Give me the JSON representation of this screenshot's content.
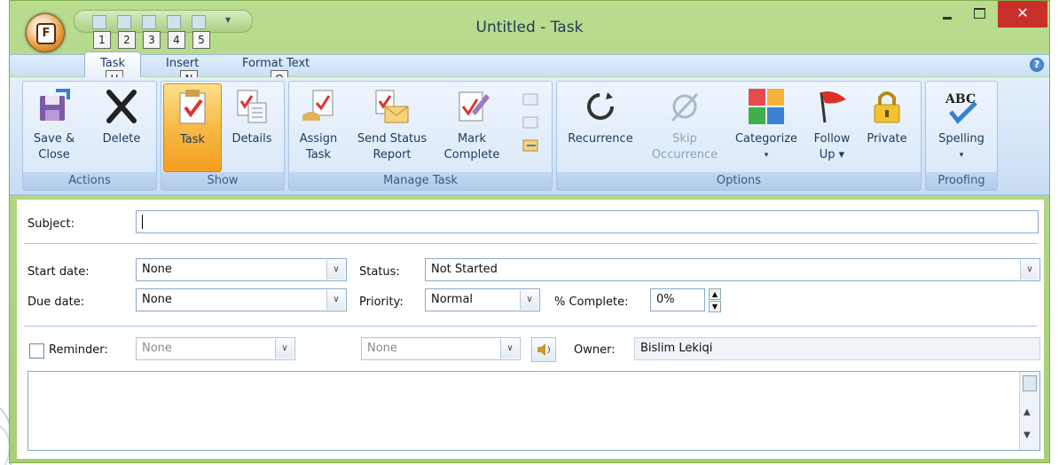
{
  "window": {
    "title": "Untitled - Task",
    "office_button_label": "F",
    "qat_keytips": [
      "1",
      "2",
      "3",
      "4",
      "5"
    ],
    "tab_keytips": [
      "H",
      "N",
      "O"
    ],
    "minimize_icon": "minimize-icon",
    "maximize_icon": "maximize-icon",
    "close_icon": "close-icon",
    "close_color": "#c9302c"
  },
  "tabs": [
    {
      "label": "Task",
      "active": true
    },
    {
      "label": "Insert",
      "active": false
    },
    {
      "label": "Format Text",
      "active": false
    }
  ],
  "help_label": "?",
  "ribbon": {
    "groups": [
      {
        "label": "Actions",
        "buttons": [
          {
            "label1": "Save &",
            "label2": "Close",
            "icon": "save-close-icon"
          },
          {
            "label1": "Delete",
            "label2": "",
            "icon": "delete-icon"
          }
        ]
      },
      {
        "label": "Show",
        "buttons": [
          {
            "label1": "Task",
            "label2": "",
            "icon": "task-icon",
            "selected": true
          },
          {
            "label1": "Details",
            "label2": "",
            "icon": "details-icon"
          }
        ]
      },
      {
        "label": "Manage Task",
        "buttons": [
          {
            "label1": "Assign",
            "label2": "Task",
            "icon": "assign-task-icon"
          },
          {
            "label1": "Send Status",
            "label2": "Report",
            "icon": "send-status-icon"
          },
          {
            "label1": "Mark",
            "label2": "Complete",
            "icon": "mark-complete-icon"
          }
        ]
      },
      {
        "label": "Options",
        "buttons": [
          {
            "label1": "Recurrence",
            "label2": "",
            "icon": "recurrence-icon"
          },
          {
            "label1": "Skip",
            "label2": "Occurrence",
            "icon": "skip-occurrence-icon",
            "disabled": true
          },
          {
            "label1": "Categorize",
            "label2": "▾",
            "icon": "categorize-icon"
          },
          {
            "label1": "Follow",
            "label2": "Up ▾",
            "icon": "follow-up-icon"
          },
          {
            "label1": "Private",
            "label2": "",
            "icon": "private-icon"
          }
        ]
      },
      {
        "label": "Proofing",
        "buttons": [
          {
            "label1": "Spelling",
            "label2": "▾",
            "icon": "spelling-icon"
          }
        ]
      }
    ]
  },
  "form": {
    "subject_label": "Subject:",
    "subject_value": "",
    "start_date_label": "Start date:",
    "start_date_value": "None",
    "due_date_label": "Due date:",
    "due_date_value": "None",
    "status_label": "Status:",
    "status_value": "Not Started",
    "priority_label": "Priority:",
    "priority_value": "Normal",
    "complete_label": "% Complete:",
    "complete_value": "0%",
    "reminder_label": "Reminder:",
    "reminder_checked": false,
    "reminder_date": "None",
    "reminder_time": "None",
    "owner_label": "Owner:",
    "owner_value": "Bislim Lekiqi",
    "dropdown_glyph": "∨",
    "spin_up": "▲",
    "spin_down": "▼"
  }
}
